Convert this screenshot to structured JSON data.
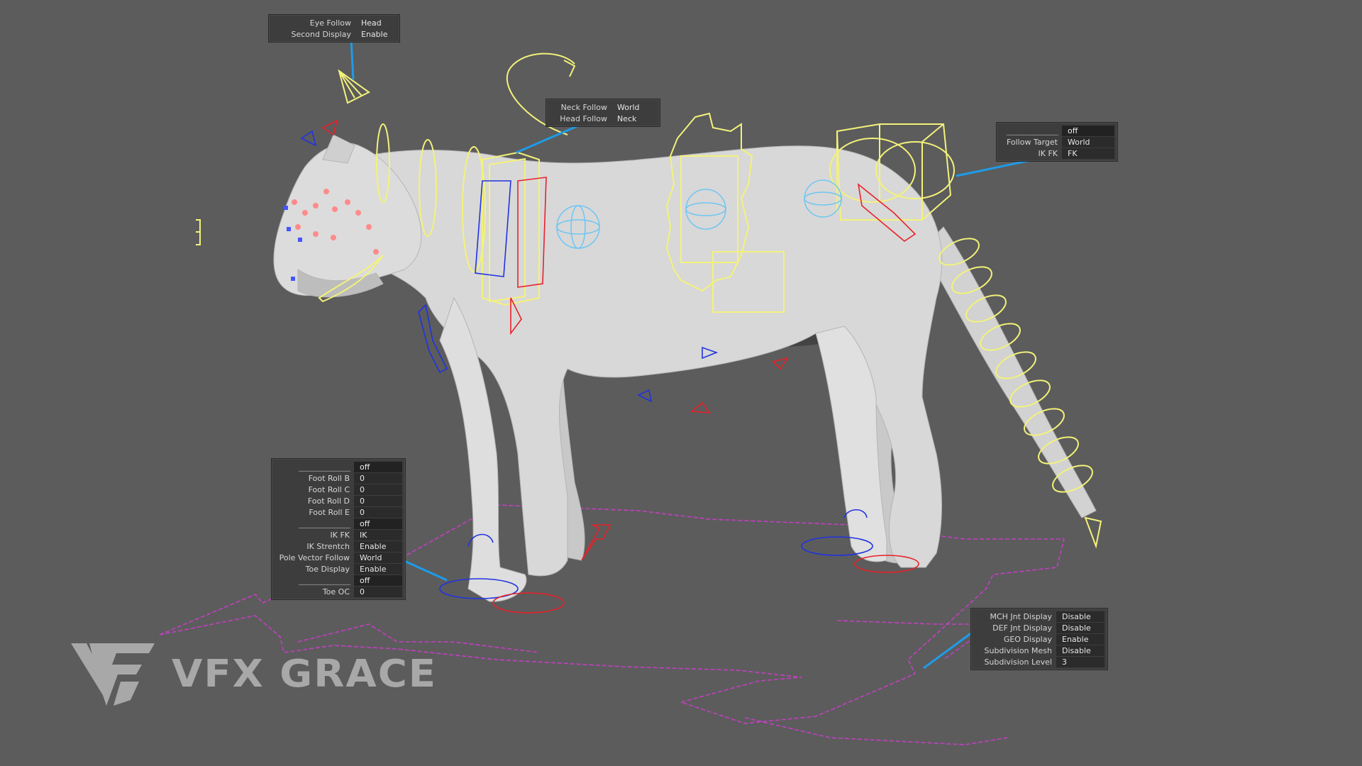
{
  "scene": {
    "colors": {
      "background": "#5c5c5c",
      "control_yellow": "#f3f27a",
      "control_red": "#e8222a",
      "control_blue": "#2133e0",
      "control_cyan": "#6fc6f2",
      "ground_magenta": "#c43fc4",
      "leader_line": "#1e9be8",
      "mesh": "#d9d9d9"
    }
  },
  "panels": {
    "head": {
      "rows": [
        {
          "label": "Eye Follow",
          "value": "Head"
        },
        {
          "label": "Second Display",
          "value": "Enable"
        }
      ]
    },
    "neck": {
      "rows": [
        {
          "label": "Neck Follow",
          "value": "World"
        },
        {
          "label": "Head Follow",
          "value": "Neck"
        }
      ]
    },
    "tail": {
      "rows": [
        {
          "label": "________________",
          "value": "off"
        },
        {
          "label": "Follow Target",
          "value": "World"
        },
        {
          "label": "IK FK",
          "value": "FK"
        }
      ]
    },
    "leg": {
      "rows": [
        {
          "label": "________________",
          "value": "off"
        },
        {
          "label": "Foot Roll B",
          "value": "0"
        },
        {
          "label": "Foot Roll C",
          "value": "0"
        },
        {
          "label": "Foot Roll D",
          "value": "0"
        },
        {
          "label": "Foot Roll E",
          "value": "0"
        },
        {
          "label": "________________",
          "value": "off"
        },
        {
          "label": "IK FK",
          "value": "IK"
        },
        {
          "label": "IK Strentch",
          "value": "Enable"
        },
        {
          "label": "Pole Vector Follow",
          "value": "World"
        },
        {
          "label": "Toe Display",
          "value": "Enable"
        },
        {
          "label": "________________",
          "value": "off"
        },
        {
          "label": "Toe OC",
          "value": "0"
        }
      ]
    },
    "global": {
      "rows": [
        {
          "label": "MCH Jnt Display",
          "value": "Disable"
        },
        {
          "label": "DEF Jnt Display",
          "value": "Disable"
        },
        {
          "label": "GEO Display",
          "value": "Enable"
        },
        {
          "label": "Subdivision Mesh",
          "value": "Disable"
        },
        {
          "label": "Subdivision Level",
          "value": "3"
        }
      ]
    }
  },
  "logo": {
    "text": "VFX GRACE",
    "icon": "vfx-grace-logo-icon"
  }
}
